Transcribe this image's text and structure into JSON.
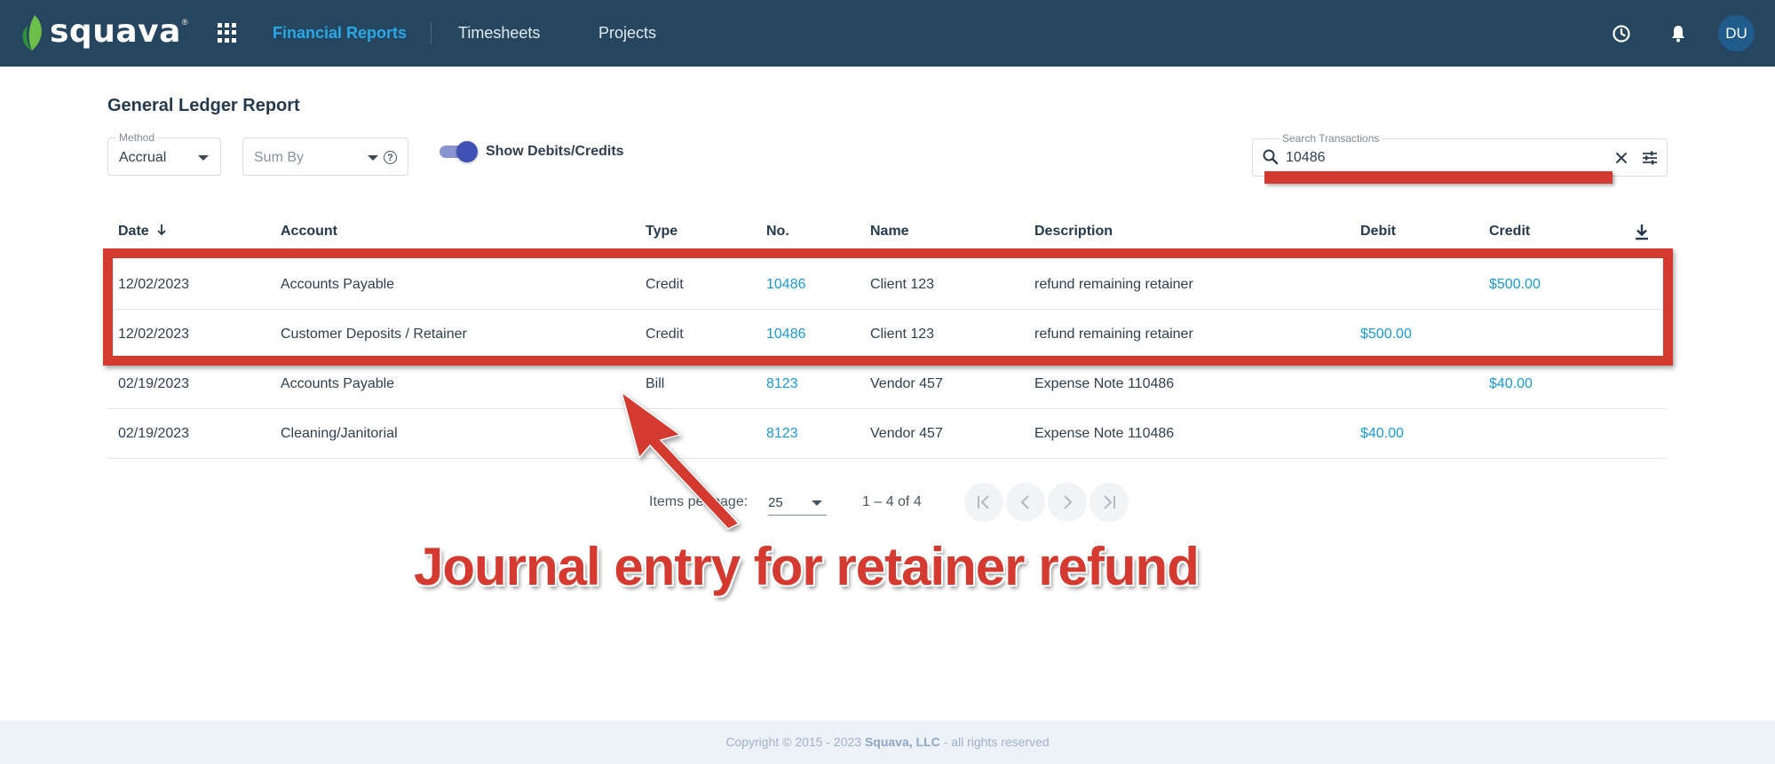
{
  "brand": {
    "logo_text": "squava",
    "trademark": "®"
  },
  "nav": {
    "items": [
      {
        "label": "Financial Reports",
        "active": true
      },
      {
        "label": "Timesheets",
        "active": false
      },
      {
        "label": "Projects",
        "active": false
      }
    ],
    "user_initials": "DU"
  },
  "report": {
    "title": "General Ledger Report",
    "method": {
      "legend": "Method",
      "value": "Accrual"
    },
    "sum_by": {
      "placeholder": "Sum By"
    },
    "toggle": {
      "label": "Show Debits/Credits",
      "on": true
    },
    "search": {
      "legend": "Search Transactions",
      "value": "10486"
    }
  },
  "table": {
    "headers": {
      "date": "Date",
      "account": "Account",
      "type": "Type",
      "no": "No.",
      "name": "Name",
      "description": "Description",
      "debit": "Debit",
      "credit": "Credit"
    },
    "rows": [
      {
        "date": "12/02/2023",
        "account": "Accounts Payable",
        "type": "Credit",
        "no": "10486",
        "name": "Client 123",
        "description": "refund remaining retainer",
        "debit": "",
        "credit": "$500.00"
      },
      {
        "date": "12/02/2023",
        "account": "Customer Deposits / Retainer",
        "type": "Credit",
        "no": "10486",
        "name": "Client 123",
        "description": "refund remaining retainer",
        "debit": "$500.00",
        "credit": ""
      },
      {
        "date": "02/19/2023",
        "account": "Accounts Payable",
        "type": "Bill",
        "no": "8123",
        "name": "Vendor 457",
        "description": "Expense Note 110486",
        "debit": "",
        "credit": "$40.00"
      },
      {
        "date": "02/19/2023",
        "account": "Cleaning/Janitorial",
        "type": "Bill",
        "no": "8123",
        "name": "Vendor 457",
        "description": "Expense Note 110486",
        "debit": "$40.00",
        "credit": ""
      }
    ]
  },
  "paginator": {
    "items_per_page_label": "Items per page:",
    "page_size": "25",
    "range": "1 – 4 of 4"
  },
  "annotation": {
    "caption": "Journal entry for retainer refund",
    "color": "#d43a2f"
  },
  "footer": {
    "prefix": "Copyright © 2015 - 2023 ",
    "company": "Squava, LLC",
    "suffix": " - all rights reserved"
  },
  "colors": {
    "topbar": "#26455f",
    "active_nav": "#29a8e6",
    "link": "#1a9ad6",
    "toggle": "#3f51b5"
  }
}
